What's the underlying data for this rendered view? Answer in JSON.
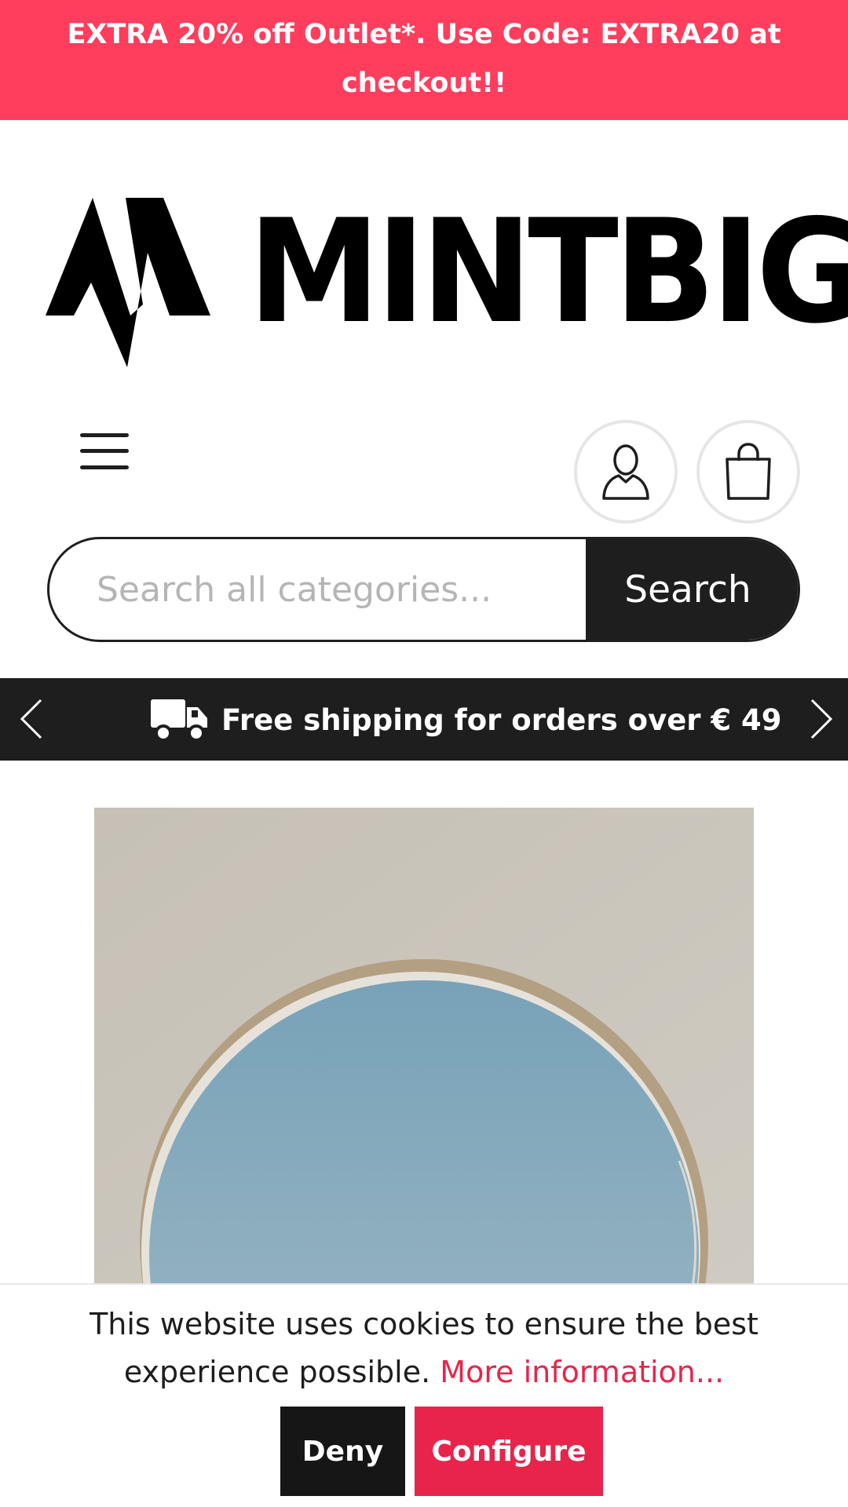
{
  "promo": {
    "line1": "EXTRA 20% off Outlet*. Use Code: EXTRA20 at",
    "line2": "checkout!!",
    "background": "#ff3d5c"
  },
  "header": {
    "logo_text": "MINTBIG",
    "menu_icon": "hamburger-menu-icon",
    "account_icon": "user-icon",
    "cart_icon": "shopping-bag-icon"
  },
  "search": {
    "placeholder": "Search all categories...",
    "button_label": "Search"
  },
  "shipping_bar": {
    "text": "Free shipping for orders over € 49",
    "icon": "truck-icon",
    "prev_icon": "chevron-left-icon",
    "next_icon": "chevron-right-icon"
  },
  "cookie": {
    "message": "This website uses cookies to ensure the best experience possible.",
    "link_label": "More information...",
    "deny_label": "Deny",
    "configure_label": "Configure",
    "accent": "#e8244a"
  }
}
